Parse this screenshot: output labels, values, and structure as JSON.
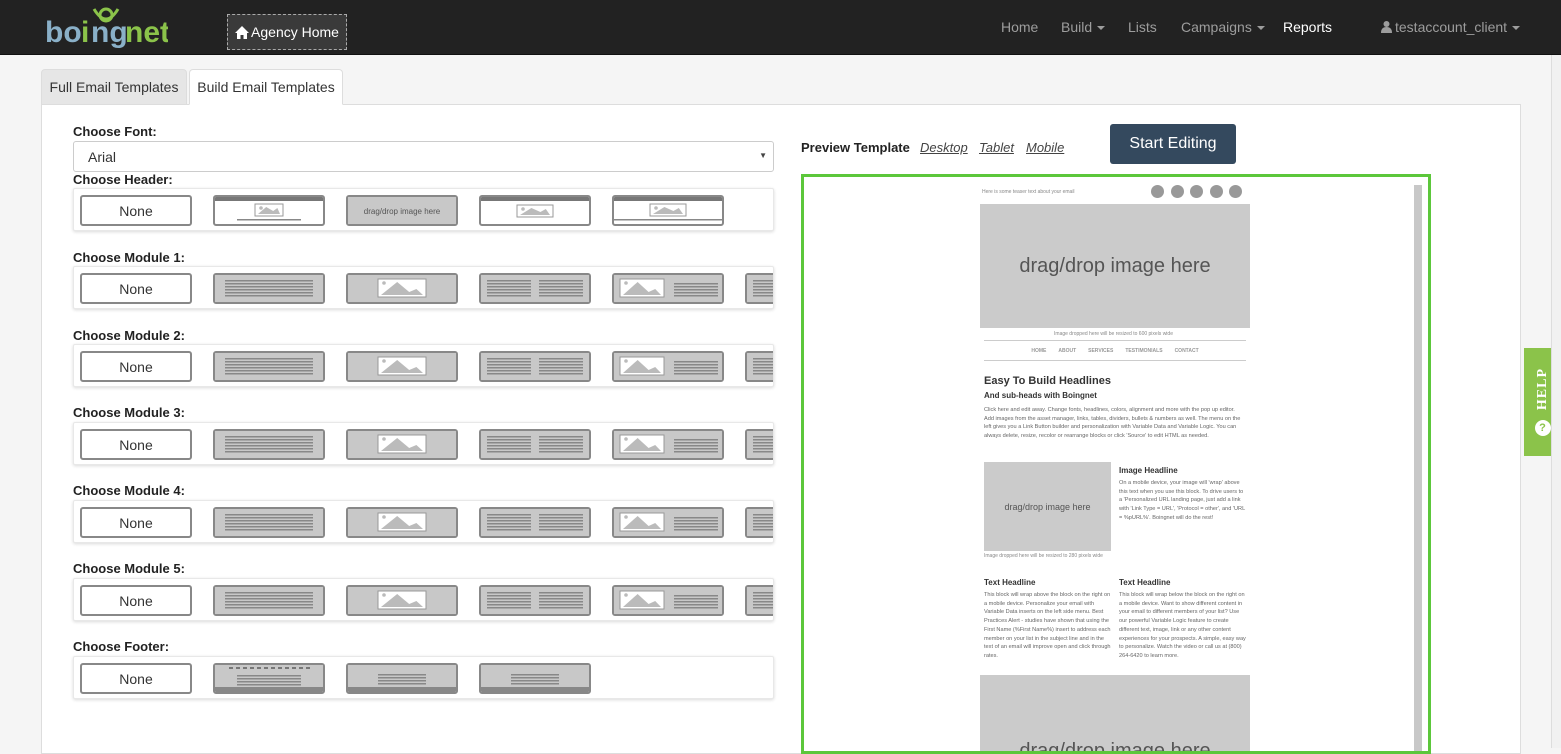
{
  "brand": {
    "logo_text": "boingnet",
    "accent_color": "#8bc34a",
    "nav_bg": "#222222"
  },
  "navbar": {
    "agency_home": "Agency Home",
    "items": [
      {
        "label": "Home",
        "dropdown": false
      },
      {
        "label": "Build",
        "dropdown": true
      },
      {
        "label": "Lists",
        "dropdown": false
      },
      {
        "label": "Campaigns",
        "dropdown": true
      },
      {
        "label": "Reports",
        "dropdown": false,
        "active": true
      }
    ],
    "user": "testaccount_client"
  },
  "tabs": [
    {
      "label": "Full Email Templates",
      "active": false
    },
    {
      "label": "Build Email Templates",
      "active": true
    }
  ],
  "builder": {
    "font_label": "Choose Font:",
    "font_value": "Arial",
    "header_label": "Choose Header:",
    "module_labels": [
      "Choose Module 1:",
      "Choose Module 2:",
      "Choose Module 3:",
      "Choose Module 4:",
      "Choose Module 5:"
    ],
    "footer_label": "Choose Footer:",
    "none_label": "None",
    "header_thumb_text": "drag/drop image here"
  },
  "preview": {
    "label": "Preview Template",
    "links": [
      "Desktop",
      "Tablet",
      "Mobile"
    ],
    "start_button": "Start Editing",
    "frame_color": "#5cc73b"
  },
  "email": {
    "teaser": "Here is some teaser text about your email",
    "hero_text": "drag/drop image here",
    "hero_caption": "Image dropped here will be resized to 600 pixels wide",
    "nav": [
      "HOME",
      "ABOUT",
      "SERVICES",
      "TESTIMONIALS",
      "CONTACT"
    ],
    "headline": "Easy To Build Headlines",
    "subhead": "And sub-heads with Boingnet",
    "intro": "Click here and edit away. Change fonts, headlines, colors, alignment and more with the pop up editor. Add images from the asset manager, links, tables, dividers, bullets & numbers as well. The menu on the left gives you a Link Button builder and personalization with Variable Data and Variable Logic. You can always delete, resize, recolor or rearrange blocks or click 'Source' to edit HTML as needed.",
    "image_box_text": "drag/drop image here",
    "image_caption": "Image dropped here will be resized to 280 pixels wide",
    "image_headline": "Image Headline",
    "image_text": "On a mobile device, your image will 'wrap' above this text when you use this block. To drive users to a 'Personalized URL landing page, just add a link with 'Link Type = URL', 'Protocol = other', and 'URL = %pURL%'. Boingnet will do the rest!",
    "text_headline_1": "Text Headline",
    "text_1": "This block will wrap above the block on the right on a mobile device. Personalize your email with Variable Data inserts on the left side menu. Best Practices Alert - studies have shown that using the First Name (%First Name%) insert to address each member on your list in the subject line and in the text of an email will improve open and click through rates.",
    "text_headline_2": "Text Headline",
    "text_2": "This block will wrap below the block on the right on a mobile device. Want to show different content in your email to different members of your list? Use our powerful Variable Logic feature to create different text, image, link or any other content experiences for your prospects. A simple, easy way to personalize. Watch the video or call us at (800) 264-6420 to learn more.",
    "hero2_text": "drag/drop image here"
  },
  "help": {
    "label": "HELP",
    "icon": "question-icon"
  }
}
